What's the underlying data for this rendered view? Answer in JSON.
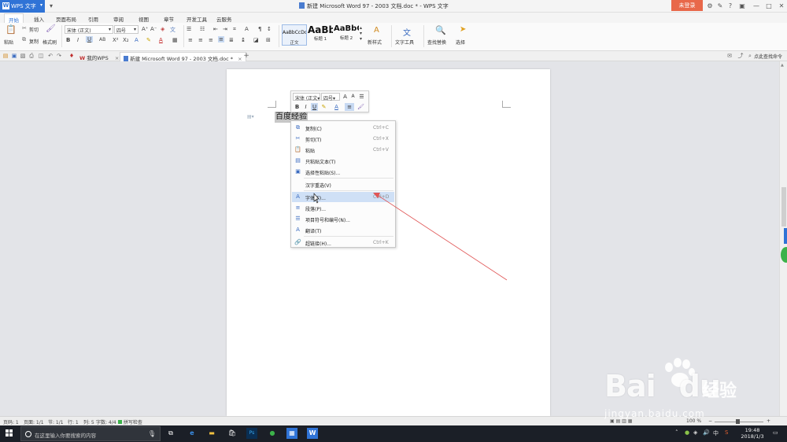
{
  "app": {
    "name": "WPS 文字",
    "window_title": "新建 Microsoft Word 97 - 2003 文档.doc * - WPS 文字",
    "login_label": "未登录"
  },
  "ribbon_tabs": [
    "开始",
    "插入",
    "页面布局",
    "引用",
    "审阅",
    "视图",
    "章节",
    "开发工具",
    "云服务"
  ],
  "ribbon": {
    "paste": "粘贴",
    "cut": "剪切",
    "copy": "复制",
    "format_painter": "格式刷",
    "font_name": "宋体 (正文)",
    "font_size": "四号",
    "styles": [
      {
        "preview": "AaBbCcDd",
        "name": "正文"
      },
      {
        "preview": "AaBb",
        "name": "标题 1"
      },
      {
        "preview": "AaBbC",
        "name": "标题 2"
      }
    ],
    "new_style": "新样式",
    "text_tools": "文字工具",
    "find_replace": "查找替换",
    "select": "选择"
  },
  "doc_tabs": [
    {
      "label": "我的WPS",
      "active": false
    },
    {
      "label": "新建 Microsoft Word 97 - 2003 文档.doc *",
      "active": true
    }
  ],
  "find_command": "点此查找命令",
  "mini_toolbar": {
    "font_name": "宋体 (正文",
    "font_size": "四号"
  },
  "document": {
    "selected_text": "百度经验"
  },
  "context_menu": [
    {
      "icon": "copy-icon",
      "label": "复制(C)",
      "shortcut": "Ctrl+C"
    },
    {
      "icon": "cut-icon",
      "label": "剪切(T)",
      "shortcut": "Ctrl+X"
    },
    {
      "icon": "paste-icon",
      "label": "粘贴",
      "shortcut": "Ctrl+V"
    },
    {
      "icon": "paste-text-icon",
      "label": "只粘贴文本(T)",
      "shortcut": ""
    },
    {
      "icon": "paste-special-icon",
      "label": "选择性粘贴(S)...",
      "shortcut": ""
    },
    {
      "icon": "",
      "label": "汉字重选(V)",
      "shortcut": ""
    },
    {
      "icon": "font-icon",
      "label": "字体(F)...",
      "shortcut": "Ctrl+D",
      "highlighted": true
    },
    {
      "icon": "paragraph-icon",
      "label": "段落(P)...",
      "shortcut": ""
    },
    {
      "icon": "list-icon",
      "label": "项目符号和编号(N)...",
      "shortcut": ""
    },
    {
      "icon": "translate-icon",
      "label": "翻译(T)",
      "shortcut": ""
    },
    {
      "icon": "hyperlink-icon",
      "label": "超链接(H)...",
      "shortcut": "Ctrl+K"
    }
  ],
  "status_bar": {
    "page_no": "页码: 1",
    "pages": "页面: 1/1",
    "section": "节: 1/1",
    "line": "行: 1",
    "column": "列: 5",
    "word_count": "字数: 4/4",
    "spell_check": "拼写检查",
    "zoom": "100 %"
  },
  "taskbar": {
    "search_placeholder": "在这里输入你要搜索的内容",
    "ime": "中",
    "time": "19:48",
    "date": "2018/1/3"
  },
  "watermark": {
    "brand": "Bai",
    "brand_suffix": "du",
    "cn": "经验",
    "url": "jingyan.baidu.com"
  },
  "colors": {
    "accent": "#2f73d6",
    "login": "#e8684a",
    "menu_highlight": "#cfe0f6",
    "selection": "#c7c7c7",
    "arrow": "#e05555"
  }
}
